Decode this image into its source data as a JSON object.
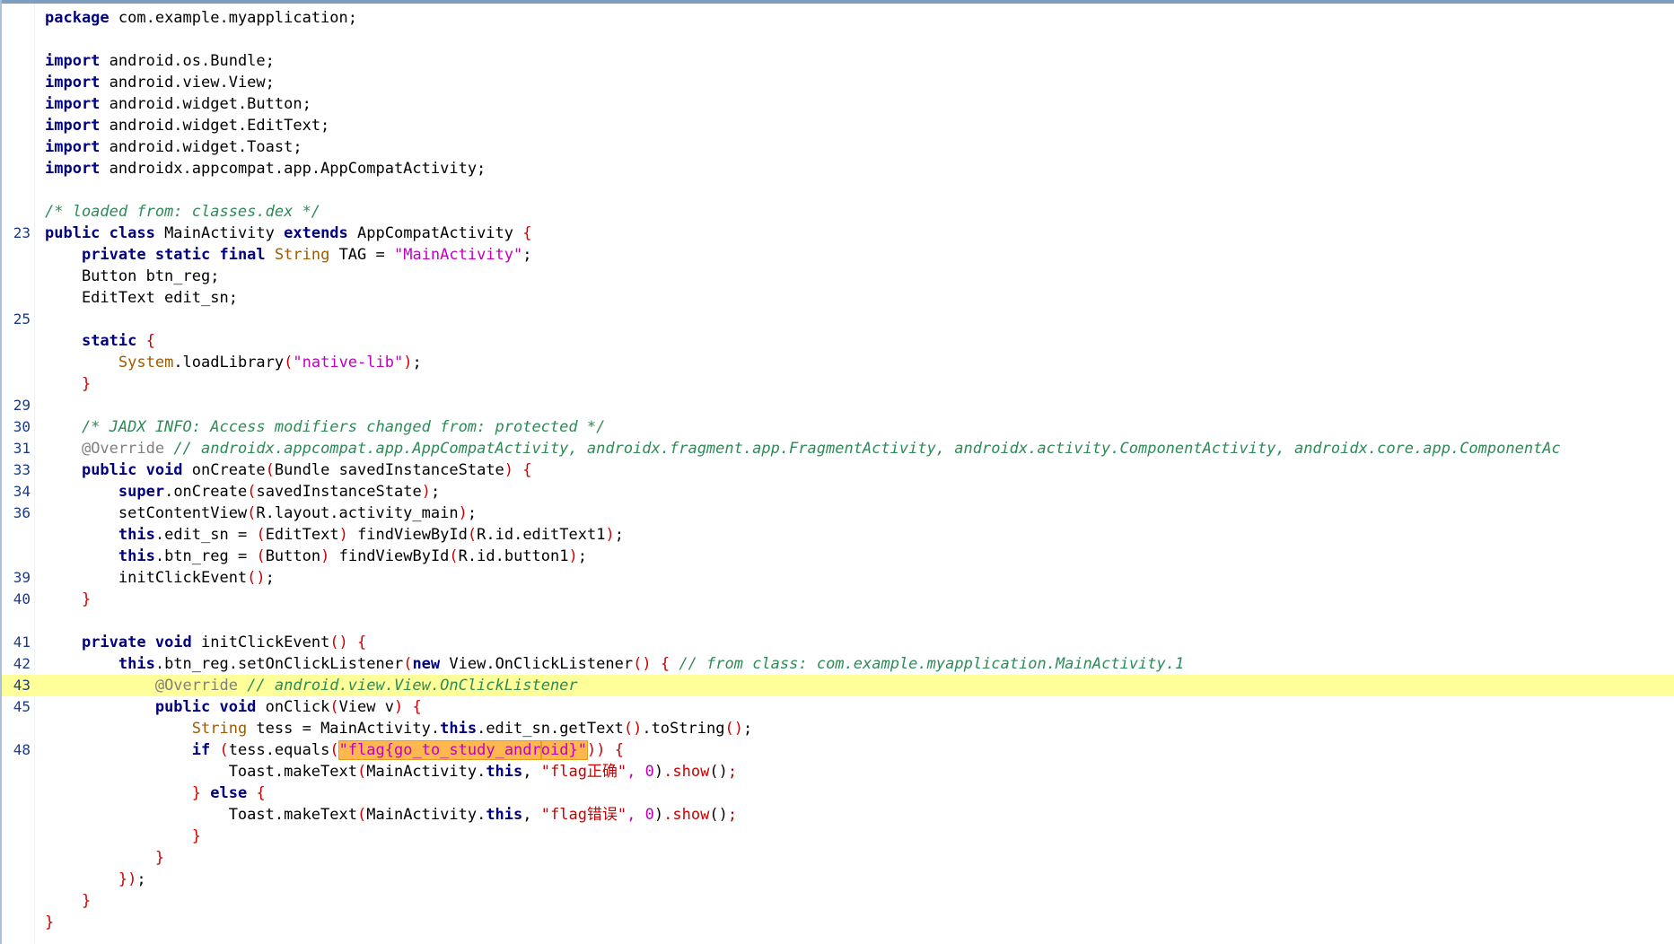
{
  "line_numbers": {
    "l10": "23",
    "l14": "25",
    "l18": "29",
    "l19": "30",
    "l20": "31",
    "l21": "33",
    "l22": "34",
    "l23": "36",
    "l26": "39",
    "l27": "40",
    "l29": "41",
    "l30": "42",
    "l31": "43",
    "l32": "45",
    "l34": "48"
  },
  "code_lines": [
    [
      "package",
      " com.example.myapplication;"
    ],
    [],
    [
      "import",
      " android.os.Bundle;"
    ],
    [
      "import",
      " android.view.View;"
    ],
    [
      "import",
      " android.widget.Button;"
    ],
    [
      "import",
      " android.widget.EditText;"
    ],
    [
      "import",
      " android.widget.Toast;"
    ],
    [
      "import",
      " androidx.appcompat.app.AppCompatActivity;"
    ],
    [],
    [
      "/* loaded from: classes.dex */"
    ],
    [
      "public class",
      " MainActivity ",
      "extends",
      " AppCompatActivity ",
      "{"
    ],
    [
      "    ",
      "private static final",
      " ",
      "String",
      " TAG = ",
      "\"MainActivity\"",
      ";"
    ],
    [
      "    Button btn_reg;"
    ],
    [
      "    EditText edit_sn;"
    ],
    [],
    [
      "    ",
      "static",
      " ",
      "{"
    ],
    [
      "        ",
      "System",
      ".loadLibrary",
      "(",
      "\"native-lib\"",
      ")",
      ";"
    ],
    [
      "    ",
      "}"
    ],
    [],
    [
      "    /* JADX INFO: Access modifiers changed from: protected */"
    ],
    [
      "    ",
      "@Override",
      " // androidx.appcompat.app.AppCompatActivity, androidx.fragment.app.FragmentActivity, androidx.activity.ComponentActivity, androidx.core.app.ComponentAc"
    ],
    [
      "    ",
      "public void",
      " onCreate",
      "(",
      "Bundle savedInstanceState",
      ")",
      " ",
      "{"
    ],
    [
      "        ",
      "super",
      ".onCreate",
      "(",
      "savedInstanceState",
      ")",
      ";"
    ],
    [
      "        setContentView",
      "(",
      "R.layout.activity_main",
      ")",
      ";"
    ],
    [
      "        ",
      "this",
      ".edit_sn = ",
      "(",
      "EditText",
      ")",
      " findViewById",
      "(",
      "R.id.editText1",
      ")",
      ";"
    ],
    [
      "        ",
      "this",
      ".btn_reg = ",
      "(",
      "Button",
      ")",
      " findViewById",
      "(",
      "R.id.button1",
      ")",
      ";"
    ],
    [
      "        initClickEvent",
      "()",
      ";"
    ],
    [
      "    ",
      "}"
    ],
    [],
    [
      "    ",
      "private void",
      " initClickEvent",
      "()",
      " ",
      "{"
    ],
    [
      "        ",
      "this",
      ".btn_reg.setOnClickListener",
      "(",
      "new",
      " View.OnClickListener",
      "()",
      " ",
      "{",
      " // from class: com.example.myapplication.MainActivity.1"
    ],
    [
      "            ",
      "@Override",
      " // android.view.View.OnClickListener"
    ],
    [
      "            ",
      "public void",
      " onClick",
      "(",
      "View v",
      ")",
      " ",
      "{"
    ],
    [
      "                ",
      "String",
      " tess = MainActivity.",
      "this",
      ".edit_sn.getText",
      "()",
      ".toString",
      "()",
      ";"
    ],
    [
      "                ",
      "if",
      " ",
      "(",
      "tess.equals",
      "(",
      "\"flag{go_to_study_andr",
      "oid}\"",
      "))",
      " ",
      "{"
    ],
    [
      "                    Toast.makeText",
      "(",
      "MainActivity.",
      "this",
      ", ",
      "\"flag正确\"",
      ", 0",
      ")",
      ".show",
      "()",
      ";"
    ],
    [
      "                ",
      "}",
      " ",
      "else",
      " ",
      "{"
    ],
    [
      "                    Toast.makeText",
      "(",
      "MainActivity.",
      "this",
      ", ",
      "\"flag错误\"",
      ", 0",
      ")",
      ".show",
      "()",
      ";"
    ],
    [
      "                ",
      "}"
    ],
    [
      "            ",
      "}"
    ],
    [
      "        })",
      ";"
    ],
    [
      "    ",
      "}"
    ],
    [
      "}"
    ]
  ],
  "colors": {
    "keyword": "#000080",
    "string": "#c000c0",
    "comment": "#2e8b57",
    "annotation": "#7f7f7f",
    "type": "#a05a00",
    "bracket": "#cc0000",
    "line_number": "#1a3a8a",
    "highlight_line": "#ffff99",
    "search_match": "#ffb84d"
  },
  "highlighted_line_number": "43"
}
